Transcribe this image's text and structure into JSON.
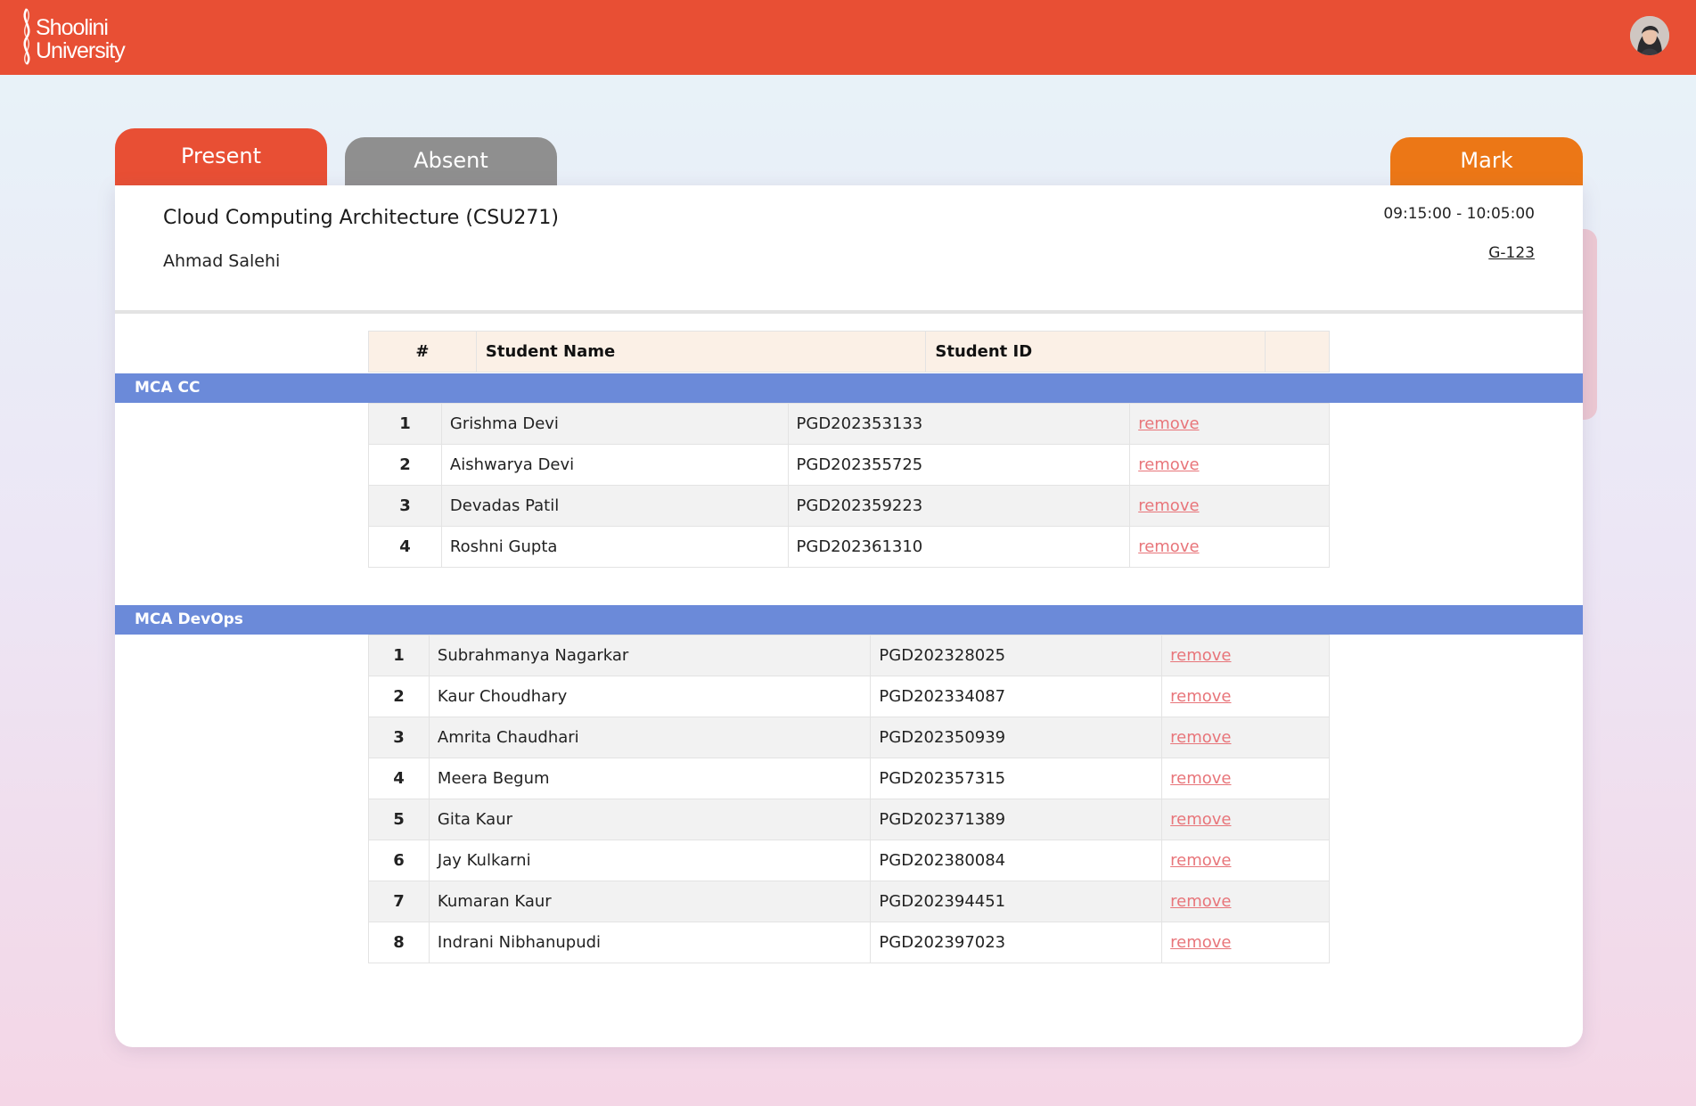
{
  "header": {
    "logo_line1": "Shoolini",
    "logo_line2": "University",
    "brand_color": "#e84f34"
  },
  "tabs": {
    "present": "Present",
    "absent": "Absent",
    "mark": "Mark"
  },
  "session": {
    "course_title": "Cloud Computing Architecture (CSU271)",
    "teacher": "Ahmad Salehi",
    "time": "09:15:00 - 10:05:00",
    "room": "G-123"
  },
  "table_header": {
    "num": "#",
    "name": "Student Name",
    "id": "Student ID",
    "action": ""
  },
  "groups": [
    {
      "name": "MCA CC",
      "students": [
        {
          "num": "1",
          "name": "Grishma Devi",
          "id": "PGD202353133",
          "action": "remove"
        },
        {
          "num": "2",
          "name": "Aishwarya Devi",
          "id": "PGD202355725",
          "action": "remove"
        },
        {
          "num": "3",
          "name": "Devadas Patil",
          "id": "PGD202359223",
          "action": "remove"
        },
        {
          "num": "4",
          "name": "Roshni Gupta",
          "id": "PGD202361310",
          "action": "remove"
        }
      ]
    },
    {
      "name": "MCA DevOps",
      "students": [
        {
          "num": "1",
          "name": "Subrahmanya Nagarkar",
          "id": "PGD202328025",
          "action": "remove"
        },
        {
          "num": "2",
          "name": "Kaur Choudhary",
          "id": "PGD202334087",
          "action": "remove"
        },
        {
          "num": "3",
          "name": "Amrita Chaudhari",
          "id": "PGD202350939",
          "action": "remove"
        },
        {
          "num": "4",
          "name": "Meera Begum",
          "id": "PGD202357315",
          "action": "remove"
        },
        {
          "num": "5",
          "name": "Gita Kaur",
          "id": "PGD202371389",
          "action": "remove"
        },
        {
          "num": "6",
          "name": "Jay Kulkarni",
          "id": "PGD202380084",
          "action": "remove"
        },
        {
          "num": "7",
          "name": "Kumaran Kaur",
          "id": "PGD202394451",
          "action": "remove"
        },
        {
          "num": "8",
          "name": "Indrani Nibhanupudi",
          "id": "PGD202397023",
          "action": "remove"
        }
      ]
    }
  ]
}
